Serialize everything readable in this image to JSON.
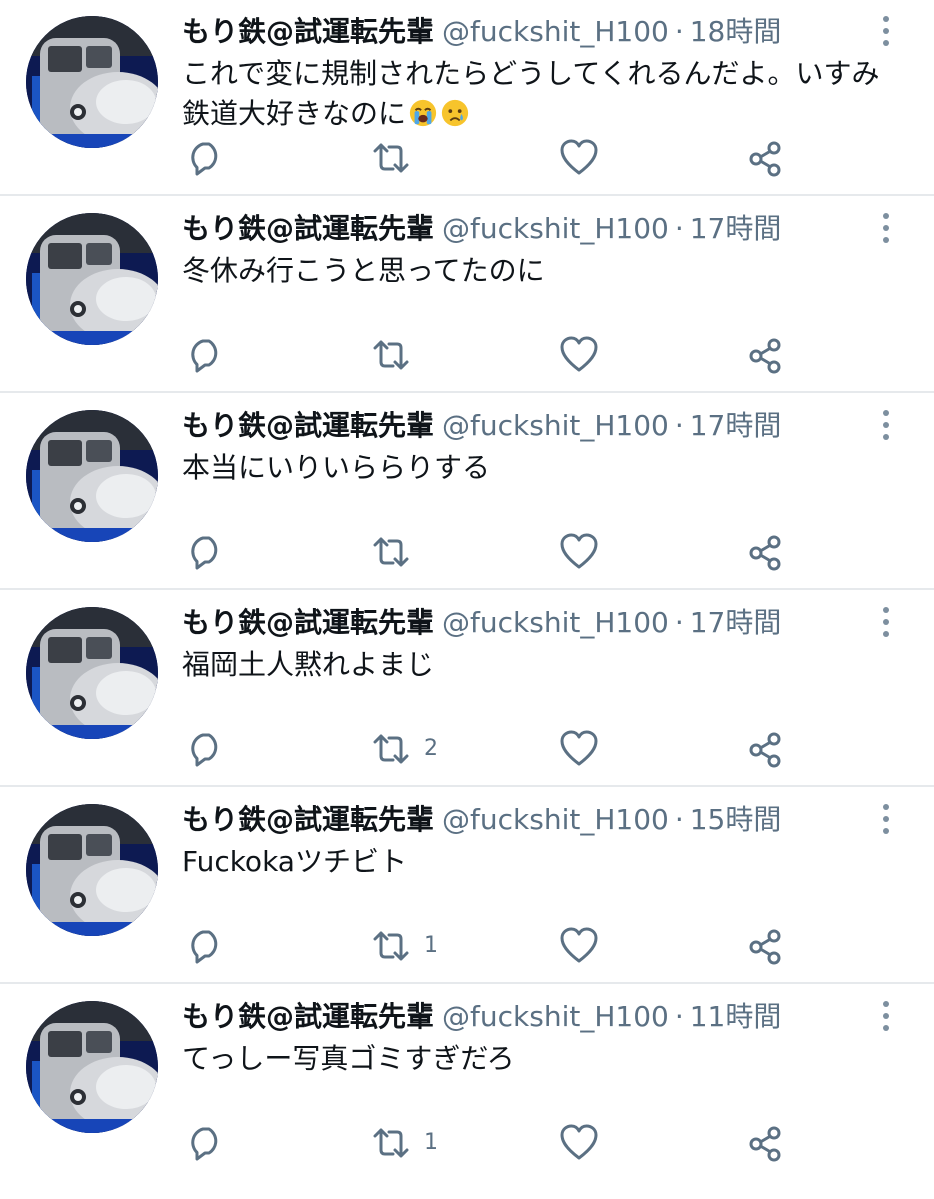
{
  "tweets": [
    {
      "display_name": "もり鉄@試運転先輩",
      "handle": "@fuckshit_H100",
      "separator": "·",
      "time": "18時間",
      "text": "これで変に規制されたらどうしてくれるんだよ。いすみ\n鉄道大好きなのに",
      "emojis": [
        "loudly-crying-face",
        "crying-face"
      ],
      "retweet_count": ""
    },
    {
      "display_name": "もり鉄@試運転先輩",
      "handle": "@fuckshit_H100",
      "separator": "·",
      "time": "17時間",
      "text": "冬休み行こうと思ってたのに",
      "retweet_count": ""
    },
    {
      "display_name": "もり鉄@試運転先輩",
      "handle": "@fuckshit_H100",
      "separator": "·",
      "time": "17時間",
      "text": "本当にいりいららりする",
      "retweet_count": ""
    },
    {
      "display_name": "もり鉄@試運転先輩",
      "handle": "@fuckshit_H100",
      "separator": "·",
      "time": "17時間",
      "text": "福岡土人黙れよまじ",
      "retweet_count": "2"
    },
    {
      "display_name": "もり鉄@試運転先輩",
      "handle": "@fuckshit_H100",
      "separator": "·",
      "time": "15時間",
      "text": "Fuckokaツチビト",
      "retweet_count": "1"
    },
    {
      "display_name": "もり鉄@試運転先輩",
      "handle": "@fuckshit_H100",
      "separator": "·",
      "time": "11時間",
      "text": "てっしー写真ゴミすぎだろ",
      "retweet_count": "1"
    }
  ],
  "icons": {
    "reply": "reply-icon",
    "retweet": "retweet-icon",
    "like": "heart-icon",
    "share": "share-icon",
    "more": "more-options-icon"
  },
  "colors": {
    "text_primary": "#0f1419",
    "text_secondary": "#5b7083",
    "icon": "#5b7083",
    "divider": "#e6e9ec",
    "avatar_background": "#0d1a52"
  }
}
